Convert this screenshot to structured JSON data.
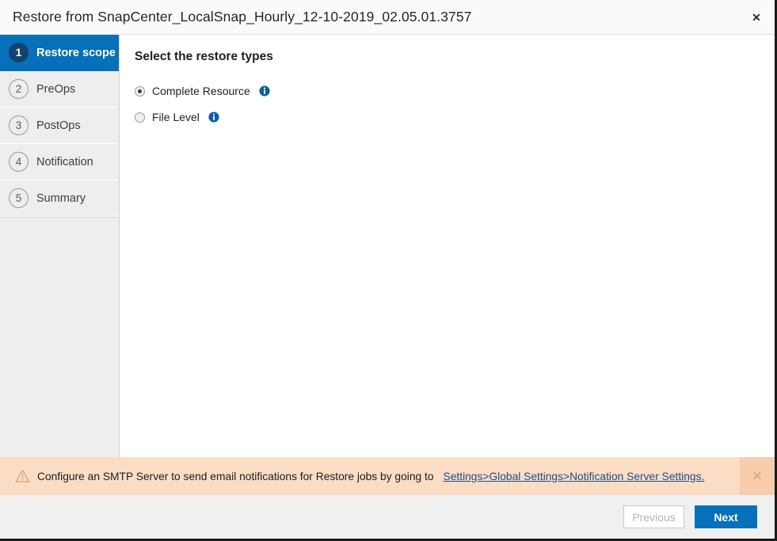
{
  "window": {
    "title": "Restore from SnapCenter_LocalSnap_Hourly_12-10-2019_02.05.01.3757",
    "close_label": "✕"
  },
  "sidebar": {
    "steps": [
      {
        "num": "1",
        "label": "Restore scope",
        "active": true
      },
      {
        "num": "2",
        "label": "PreOps",
        "active": false
      },
      {
        "num": "3",
        "label": "PostOps",
        "active": false
      },
      {
        "num": "4",
        "label": "Notification",
        "active": false
      },
      {
        "num": "5",
        "label": "Summary",
        "active": false
      }
    ]
  },
  "main": {
    "heading": "Select the restore types",
    "options": [
      {
        "label": "Complete Resource",
        "selected": true
      },
      {
        "label": "File Level",
        "selected": false
      }
    ]
  },
  "banner": {
    "message": "Configure an SMTP Server to send email notifications for Restore jobs by going to",
    "link": "Settings>Global Settings>Notification Server Settings.",
    "close_label": "✕"
  },
  "footer": {
    "previous_label": "Previous",
    "next_label": "Next"
  },
  "colors": {
    "accent_blue": "#0670ba",
    "step_circle_active": "#12436e",
    "banner_bg": "#fbdcc5",
    "banner_close_bg": "#f7cdae",
    "link_blue": "#1c4e8a",
    "sidebar_bg": "#eeeeee",
    "footer_bg": "#f0f0f0"
  }
}
